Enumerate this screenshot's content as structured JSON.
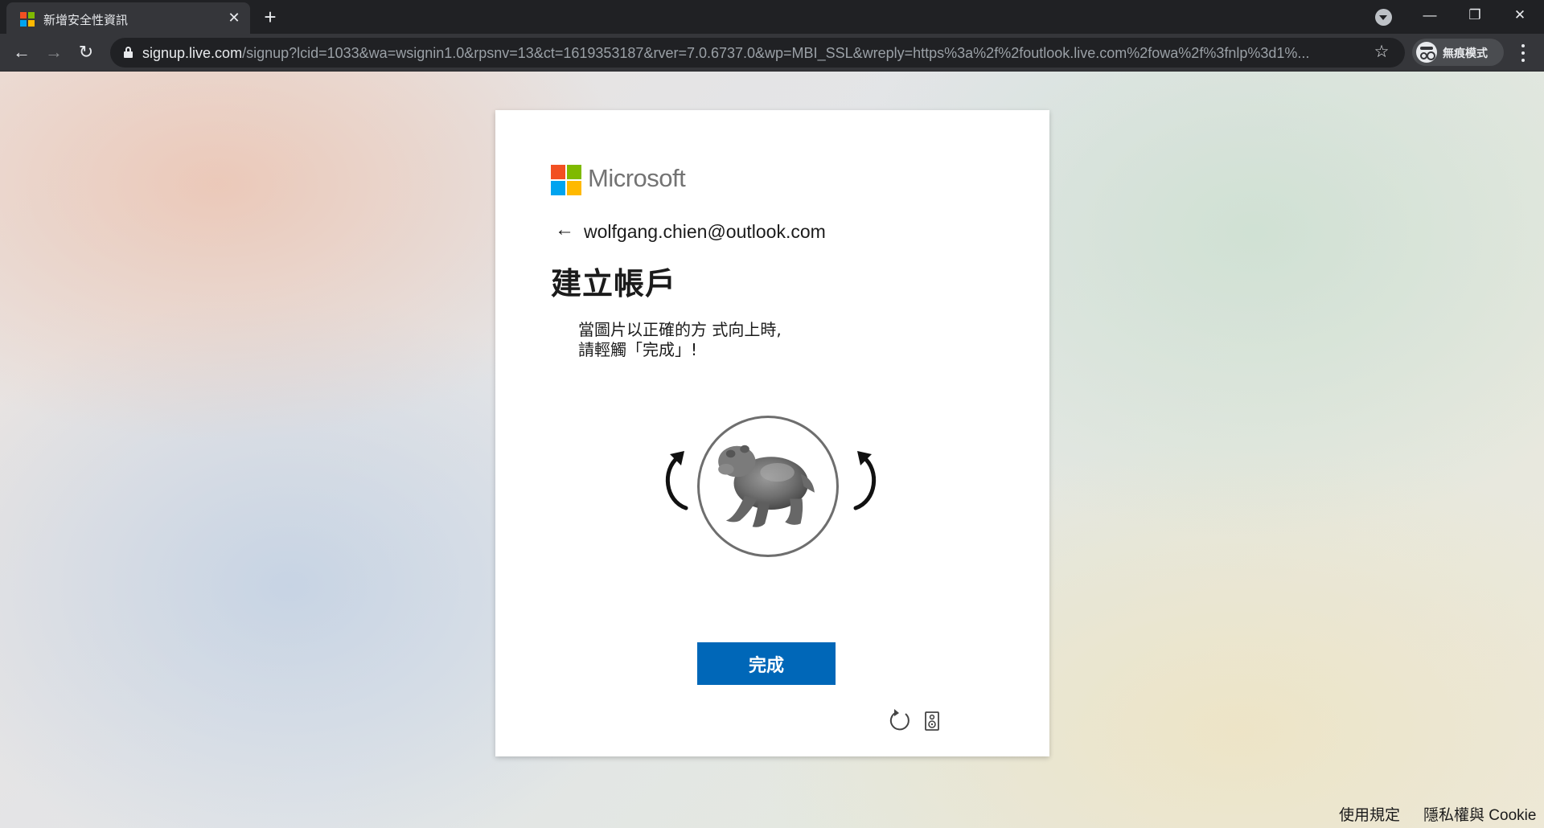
{
  "browser": {
    "tab_title": "新增安全性資訊",
    "tab_close": "✕",
    "new_tab": "+",
    "url_host": "signup.live.com",
    "url_path": "/signup?lcid=1033&wa=wsignin1.0&rpsnv=13&ct=1619353187&rver=7.0.6737.0&wp=MBI_SSL&wreply=https%3a%2f%2foutlook.live.com%2fowa%2f%3fnlp%3d1%...",
    "back": "←",
    "forward": "→",
    "reload": "↻",
    "star": "☆",
    "incognito_label": "無痕模式",
    "minimize": "—",
    "restore": "❐",
    "close": "✕"
  },
  "signup": {
    "brand": "Microsoft",
    "back_arrow": "←",
    "identity": "wolfgang.chien@outlook.com",
    "title": "建立帳戶",
    "instruction_line1": "當圖片以正確的方 式向上時,",
    "instruction_line2": "請輕觸「完成」!",
    "done_label": "完成"
  },
  "footer": {
    "terms": "使用規定",
    "privacy": "隱私權與 Cookie"
  },
  "colors": {
    "ms_red": "#f25022",
    "ms_green": "#7fba00",
    "ms_blue": "#00a4ef",
    "ms_yellow": "#ffb900",
    "primary_button": "#0067b8"
  }
}
